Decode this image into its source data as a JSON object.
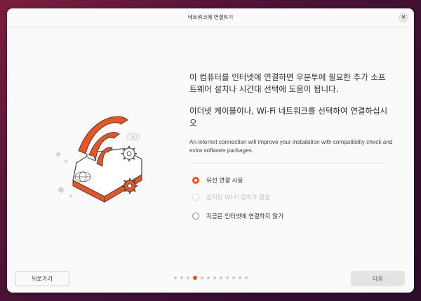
{
  "window": {
    "title": "네트워크에 연결하기",
    "close_glyph": "✕"
  },
  "heading": {
    "line1": "이 컴퓨터를 인터넷에 연결하면 우분투에 필요한 추가 소프트웨어 설치나 시간대 선택에 도움이 됩니다.",
    "line2": "이더넷 케이블이나, Wi-Fi 네트워크를 선택하여 연결하십시오"
  },
  "description": "An internet connection will improve your installation with compatibility check and extra software packages.",
  "options": [
    {
      "label": "유선 연결 사용",
      "selected": true,
      "enabled": true
    },
    {
      "label": "감지된 Wi-Fi 장치가 없음",
      "selected": false,
      "enabled": false
    },
    {
      "label": "지금은 인터넷에 연결하지 않기",
      "selected": false,
      "enabled": true
    }
  ],
  "footer": {
    "back_label": "뒤로가기",
    "next_label": "다음",
    "pages_total": 12,
    "page_current": 4
  },
  "colors": {
    "accent": "#e95420",
    "window_bg": "#fafafa"
  },
  "illustration": "wifi-cloud-gears"
}
